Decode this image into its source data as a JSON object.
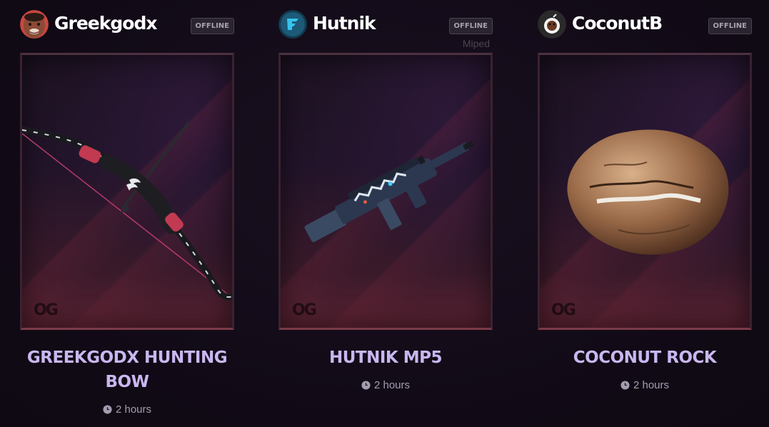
{
  "colors": {
    "title": "#c9b7f0",
    "username": "#ffffff",
    "badge_text": "#a9a2ad",
    "background": "#120b18"
  },
  "cards": [
    {
      "username": "Greekgodx",
      "avatar_icon": "face-avatar-icon",
      "status": "OFFLINE",
      "sub_label": "",
      "item_icon": "hunting-bow-icon",
      "item_title": "GREEKGODX HUNTING BOW",
      "watermark": "OG",
      "time": "2 hours"
    },
    {
      "username": "Hutnik",
      "avatar_icon": "hutnik-logo-avatar-icon",
      "status": "OFFLINE",
      "sub_label": "Miped",
      "item_icon": "mp5-gun-icon",
      "item_title": "HUTNIK MP5",
      "watermark": "OG",
      "time": "2 hours"
    },
    {
      "username": "CoconutB",
      "avatar_icon": "coconut-avatar-icon",
      "status": "OFFLINE",
      "sub_label": "",
      "item_icon": "coconut-rock-icon",
      "item_title": "COCONUT ROCK",
      "watermark": "OG",
      "time": "2 hours"
    }
  ]
}
